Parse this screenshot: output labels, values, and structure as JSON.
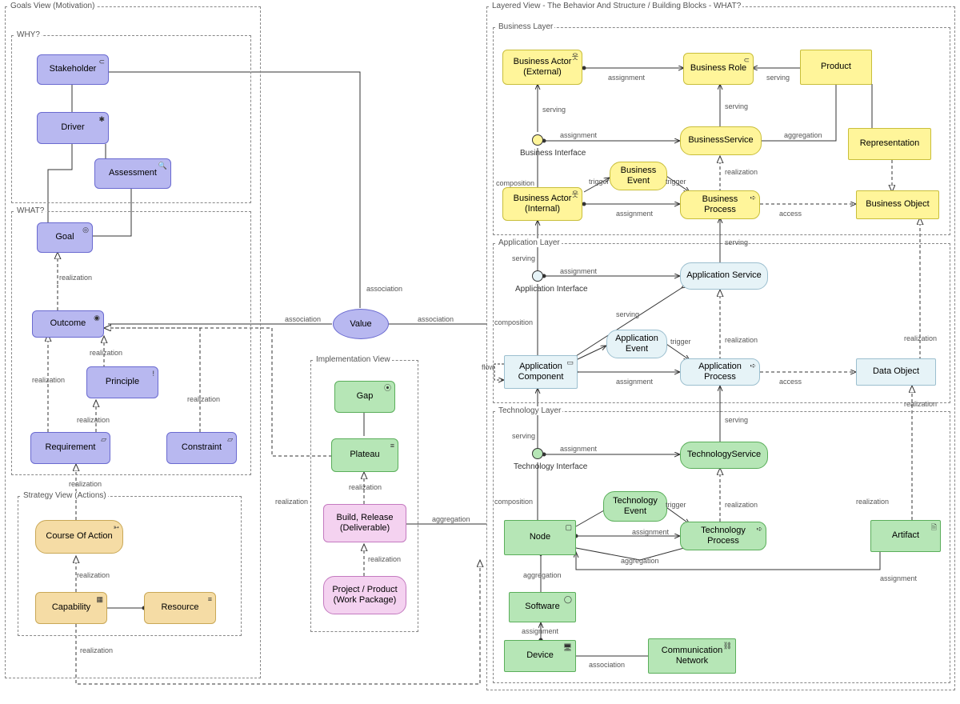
{
  "views": {
    "goals": {
      "title": "Goals View (Motivation)"
    },
    "why": {
      "title": "WHY?"
    },
    "what": {
      "title": "WHAT?"
    },
    "strategy": {
      "title": "Strategy View (Actions)"
    },
    "impl": {
      "title": "Implementation View"
    },
    "layered": {
      "title": "Layered View - The Behavior And Structure / Building Blocks - WHAT?"
    },
    "businessLayer": {
      "title": "Business Layer"
    },
    "applicationLayer": {
      "title": "Application Layer"
    },
    "technologyLayer": {
      "title": "Technology Layer"
    }
  },
  "nodes": {
    "stakeholder": {
      "label": "Stakeholder"
    },
    "driver": {
      "label": "Driver"
    },
    "assessment": {
      "label": "Assessment"
    },
    "goal": {
      "label": "Goal"
    },
    "outcome": {
      "label": "Outcome"
    },
    "principle": {
      "label": "Principle"
    },
    "requirement": {
      "label": "Requirement"
    },
    "constraint": {
      "label": "Constraint"
    },
    "value": {
      "label": "Value"
    },
    "courseOfAction": {
      "label": "Course Of Action"
    },
    "capability": {
      "label": "Capability"
    },
    "resource": {
      "label": "Resource"
    },
    "gap": {
      "label": "Gap"
    },
    "plateau": {
      "label": "Plateau"
    },
    "deliverable": {
      "label": "Build, Release (Deliverable)"
    },
    "workpackage": {
      "label": "Project / Product (Work Package)"
    },
    "bizActorExt": {
      "label": "Business Actor (External)"
    },
    "bizRole": {
      "label": "Business Role"
    },
    "product": {
      "label": "Product"
    },
    "bizInterface": {
      "label": "Business Interface"
    },
    "bizService": {
      "label": "BusinessService"
    },
    "representation": {
      "label": "Representation"
    },
    "bizEvent": {
      "label": "Business Event"
    },
    "bizActorInt": {
      "label": "Business Actor (Internal)"
    },
    "bizProcess": {
      "label": "Business Process"
    },
    "bizObject": {
      "label": "Business Object"
    },
    "appInterface": {
      "label": "Application Interface"
    },
    "appService": {
      "label": "Application Service"
    },
    "appEvent": {
      "label": "Application Event"
    },
    "appComponent": {
      "label": "Application Component"
    },
    "appProcess": {
      "label": "Application Process"
    },
    "dataObject": {
      "label": "Data Object"
    },
    "techInterface": {
      "label": "Technology Interface"
    },
    "techService": {
      "label": "TechnologyService"
    },
    "techEvent": {
      "label": "Technology Event"
    },
    "nodeEl": {
      "label": "Node"
    },
    "techProcess": {
      "label": "Technology Process"
    },
    "artifact": {
      "label": "Artifact"
    },
    "software": {
      "label": "Software"
    },
    "device": {
      "label": "Device"
    },
    "commNetwork": {
      "label": "Communication Network"
    }
  },
  "rel": {
    "realization": "realization",
    "association": "association",
    "assignment": "assignment",
    "serving": "serving",
    "composition": "composition",
    "aggregation": "aggregation",
    "trigger": "trigger",
    "access": "access",
    "flow": "flow"
  }
}
